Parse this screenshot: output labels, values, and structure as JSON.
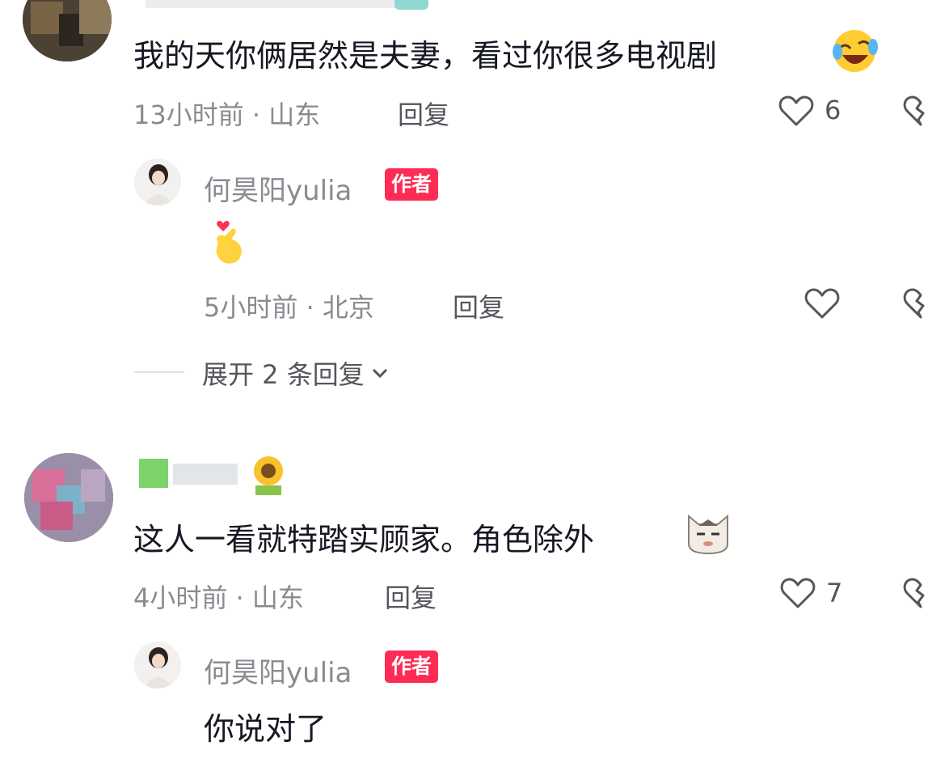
{
  "comments": [
    {
      "text": "我的天你俩居然是夫妻，看过你很多电视剧",
      "emoji": "laughing-crying-emoji",
      "time_location": "13小时前 · 山东",
      "reply_label": "回复",
      "like_count": "6",
      "reply": {
        "author": "何昊阳yulia",
        "badge": "作者",
        "emoji": "finger-heart-emoji",
        "time_location": "5小时前 · 北京",
        "reply_label": "回复"
      },
      "expand_label": "展开 2 条回复"
    },
    {
      "text": "这人一看就特踏实顾家。角色除外",
      "emoji": "smug-cat-emoji",
      "time_location": "4小时前 · 山东",
      "reply_label": "回复",
      "like_count": "7",
      "reply": {
        "author": "何昊阳yulia",
        "badge": "作者",
        "text": "你说对了"
      }
    }
  ],
  "colors": {
    "badge": "#fe2c55",
    "meta_text": "#8a8b91",
    "primary_text": "#161823"
  }
}
